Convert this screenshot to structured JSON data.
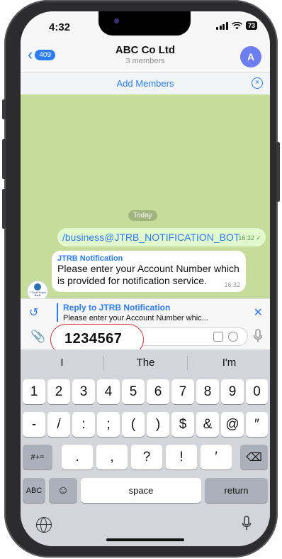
{
  "status": {
    "time": "4:32",
    "battery": "73"
  },
  "header": {
    "back_count": "409",
    "title": "ABC Co Ltd",
    "subtitle": "3 members",
    "avatar_initial": "A"
  },
  "add_members": {
    "label": "Add Members"
  },
  "chat": {
    "date_chip": "Today",
    "outgoing": {
      "text": "/business@JTRB_NOTIFICATION_BOT",
      "time": "16:32",
      "status_icon": "double-check-icon"
    },
    "incoming": {
      "sender": "JTRB Notification",
      "text": "Please enter your Account Number which is provided for notification service.",
      "time": "16:32",
      "avatar_text": "J Trust Royal Bank"
    }
  },
  "reply_bar": {
    "title": "Reply to JTRB Notification",
    "snippet": "Please enter your Account Number whic..."
  },
  "input": {
    "value": "1234567"
  },
  "keyboard": {
    "suggestions": [
      "I",
      "The",
      "I'm"
    ],
    "number_row": [
      "1",
      "2",
      "3",
      "4",
      "5",
      "6",
      "7",
      "8",
      "9",
      "0"
    ],
    "symbol_row": [
      "-",
      "/",
      ":",
      ";",
      "(",
      ")",
      "$",
      "&",
      "@",
      "″"
    ],
    "punct_row": {
      "toggle": "#+=",
      "keys": [
        ".",
        ",",
        "?",
        "!",
        "′"
      ]
    },
    "bottom_row": {
      "abc": "ABC",
      "space": "space",
      "return": "return"
    }
  },
  "colors": {
    "accent": "#2b7cf6",
    "chat_bg": "#c5dc9b",
    "outgoing_bubble": "#e2f8cd",
    "callout_border": "#d8323a"
  }
}
